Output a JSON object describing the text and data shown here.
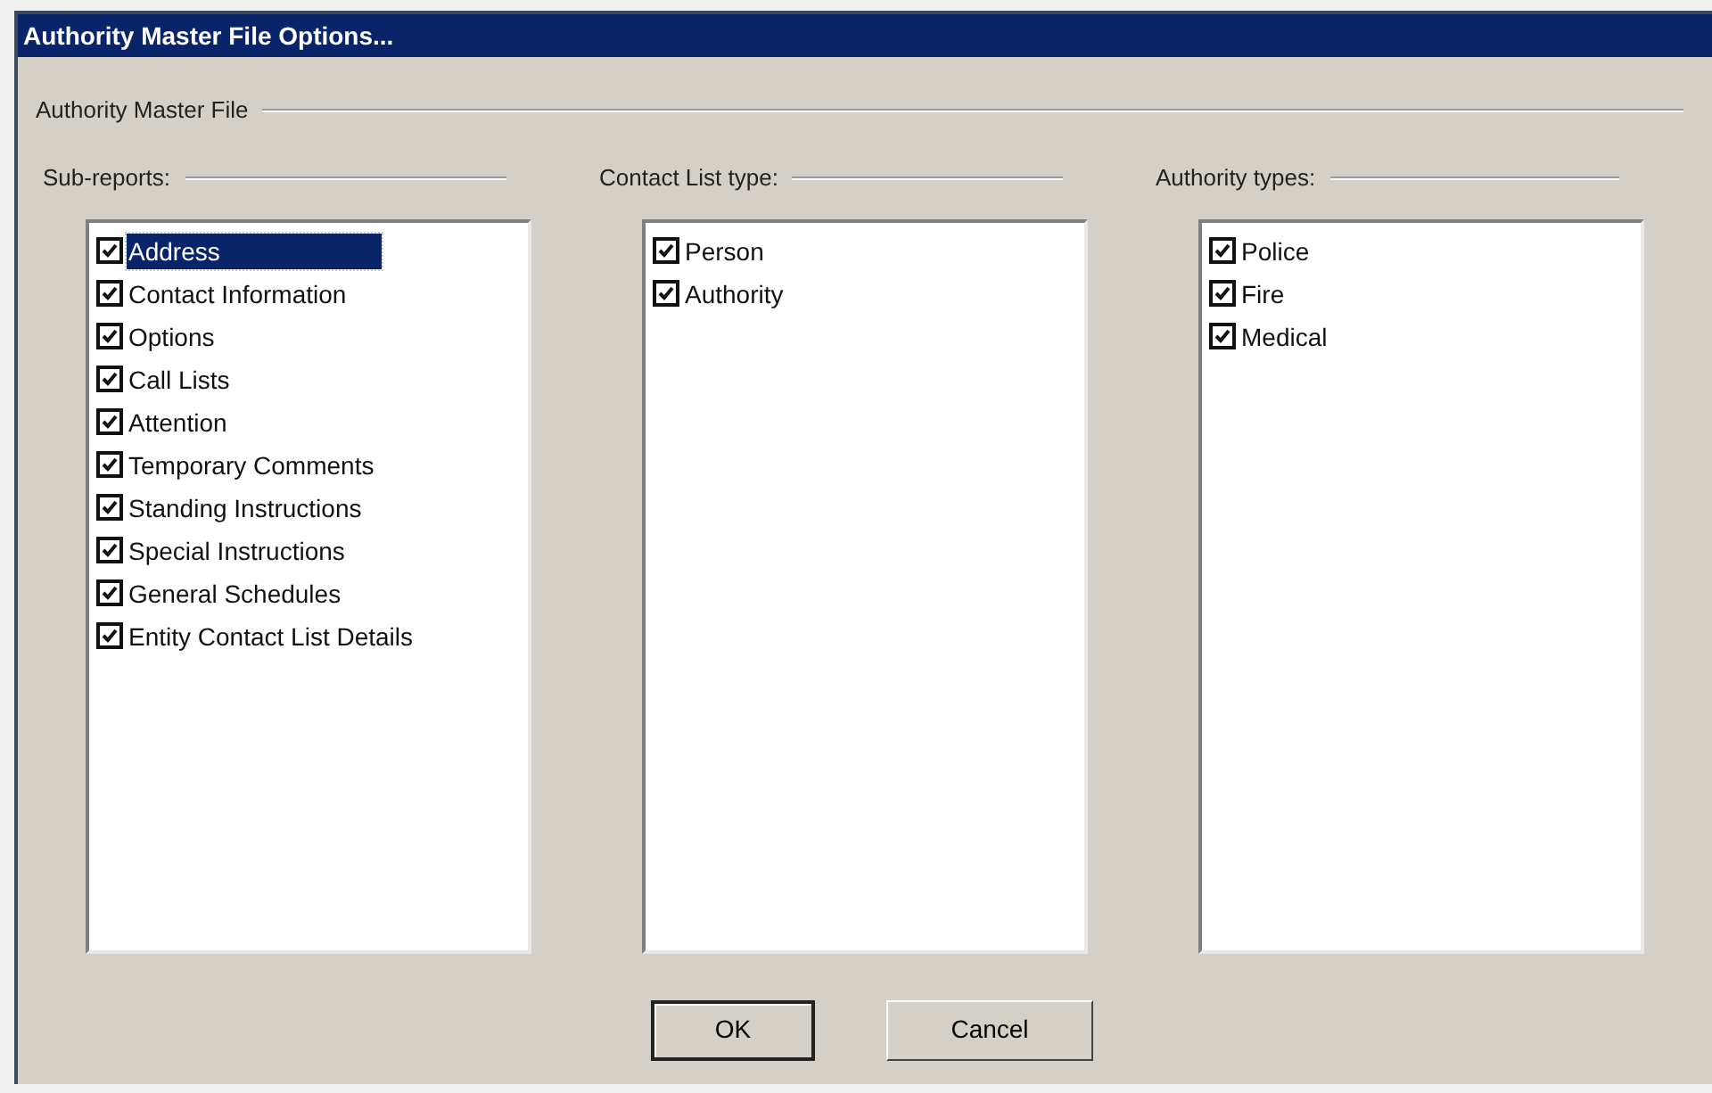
{
  "window": {
    "title": "Authority Master File Options..."
  },
  "group": {
    "label": "Authority Master File"
  },
  "lists": [
    {
      "label": "Sub-reports:",
      "items": [
        {
          "label": "Address",
          "checked": true,
          "selected": true
        },
        {
          "label": "Contact Information",
          "checked": true,
          "selected": false
        },
        {
          "label": "Options",
          "checked": true,
          "selected": false
        },
        {
          "label": "Call Lists",
          "checked": true,
          "selected": false
        },
        {
          "label": "Attention",
          "checked": true,
          "selected": false
        },
        {
          "label": "Temporary Comments",
          "checked": true,
          "selected": false
        },
        {
          "label": "Standing Instructions",
          "checked": true,
          "selected": false
        },
        {
          "label": "Special Instructions",
          "checked": true,
          "selected": false
        },
        {
          "label": "General Schedules",
          "checked": true,
          "selected": false
        },
        {
          "label": "Entity Contact List Details",
          "checked": true,
          "selected": false
        }
      ]
    },
    {
      "label": "Contact List type:",
      "items": [
        {
          "label": "Person",
          "checked": true,
          "selected": false
        },
        {
          "label": "Authority",
          "checked": true,
          "selected": false
        }
      ]
    },
    {
      "label": "Authority types:",
      "items": [
        {
          "label": "Police",
          "checked": true,
          "selected": false
        },
        {
          "label": "Fire",
          "checked": true,
          "selected": false
        },
        {
          "label": "Medical",
          "checked": true,
          "selected": false
        }
      ]
    }
  ],
  "buttons": [
    {
      "label": "OK",
      "default": true
    },
    {
      "label": "Cancel",
      "default": false
    }
  ]
}
